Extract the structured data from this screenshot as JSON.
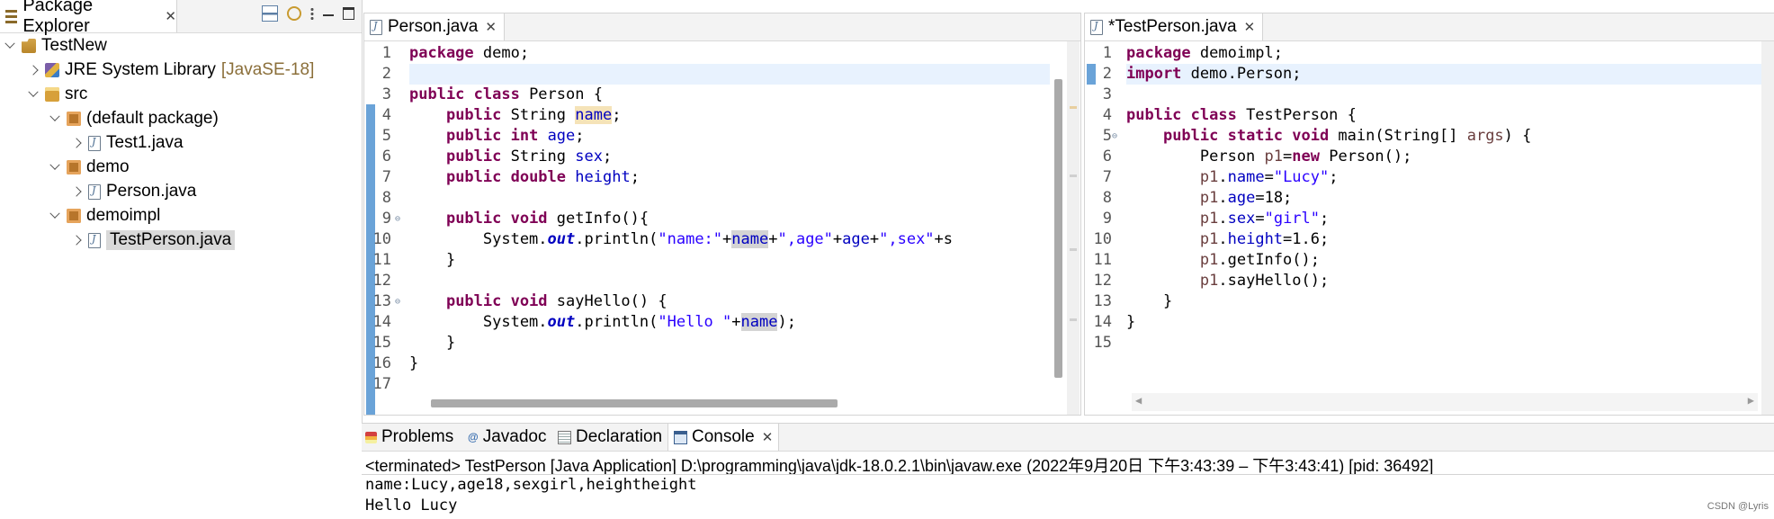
{
  "explorer": {
    "title": "Package Explorer",
    "tree": [
      {
        "label": "TestNew",
        "suffix": ""
      },
      {
        "label": "JRE System Library",
        "suffix": "[JavaSE-18]"
      },
      {
        "label": "src",
        "suffix": ""
      },
      {
        "label": "(default package)",
        "suffix": ""
      },
      {
        "label": "Test1.java",
        "suffix": ""
      },
      {
        "label": "demo",
        "suffix": ""
      },
      {
        "label": "Person.java",
        "suffix": ""
      },
      {
        "label": "demoimpl",
        "suffix": ""
      },
      {
        "label": "TestPerson.java",
        "suffix": ""
      }
    ]
  },
  "editor_left": {
    "tab": "Person.java",
    "line_numbers": [
      "1",
      "2",
      "3",
      "4",
      "5",
      "6",
      "7",
      "8",
      "9",
      "10",
      "11",
      "12",
      "13",
      "14",
      "15",
      "16",
      "17"
    ]
  },
  "editor_right": {
    "tab": "*TestPerson.java",
    "line_numbers": [
      "1",
      "2",
      "3",
      "4",
      "5",
      "6",
      "7",
      "8",
      "9",
      "10",
      "11",
      "12",
      "13",
      "14",
      "15"
    ]
  },
  "bottom": {
    "tabs": [
      "Problems",
      "Javadoc",
      "Declaration",
      "Console"
    ],
    "terminated": "<terminated> TestPerson [Java Application] D:\\programming\\java\\jdk-18.0.2.1\\bin\\javaw.exe  (2022年9月20日 下午3:43:39 – 下午3:43:41) [pid: 36492]",
    "output": [
      "name:Lucy,age18,sexgirl,heightheight",
      "Hello Lucy"
    ],
    "watermark": "CSDN @Lyris"
  },
  "colors": {
    "keyword": "#7f0055",
    "field": "#0000c0",
    "string": "#2a00ff",
    "change_bar": "#6aa3d8"
  }
}
